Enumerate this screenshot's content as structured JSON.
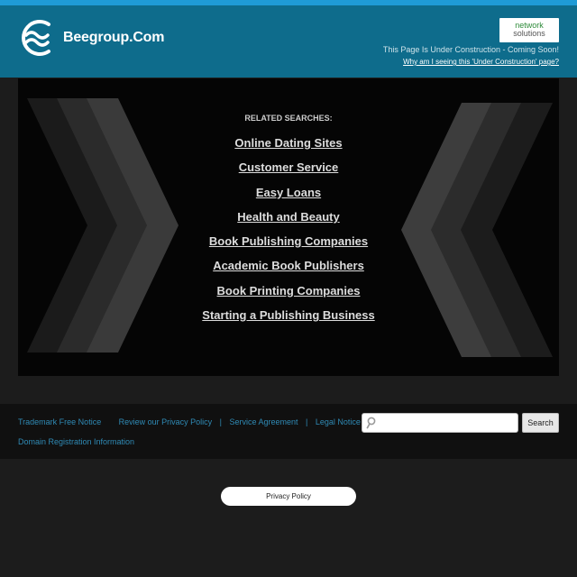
{
  "header": {
    "site_title": "Beegroup.Com",
    "partner_logo_line1": "network",
    "partner_logo_line2": "solutions",
    "construction_text": "This Page Is Under Construction - Coming Soon!",
    "construction_link": "Why am I seeing this 'Under Construction' page?"
  },
  "related": {
    "heading": "RELATED SEARCHES:",
    "items": [
      "Online Dating Sites",
      "Customer Service",
      "Easy Loans",
      "Health and Beauty",
      "Book Publishing Companies",
      "Academic Book Publishers",
      "Book Printing Companies",
      "Starting a Publishing Business"
    ]
  },
  "footer": {
    "links": [
      "Trademark Free Notice",
      "Review our Privacy Policy",
      "Service Agreement",
      "Legal Notice"
    ],
    "separator": "|",
    "row2_link": "Domain Registration Information"
  },
  "search": {
    "placeholder": "",
    "value": "",
    "button_label": "Search"
  },
  "privacy_pill": "Privacy Policy",
  "colors": {
    "header_bg": "#0e6c8c",
    "top_stripe": "#1f9bd6",
    "footer_link": "#2f8ab5",
    "page_bg": "#1c1c1c"
  },
  "icons": {
    "logo": "wave-swirl-logo",
    "search": "magnifier-icon"
  }
}
